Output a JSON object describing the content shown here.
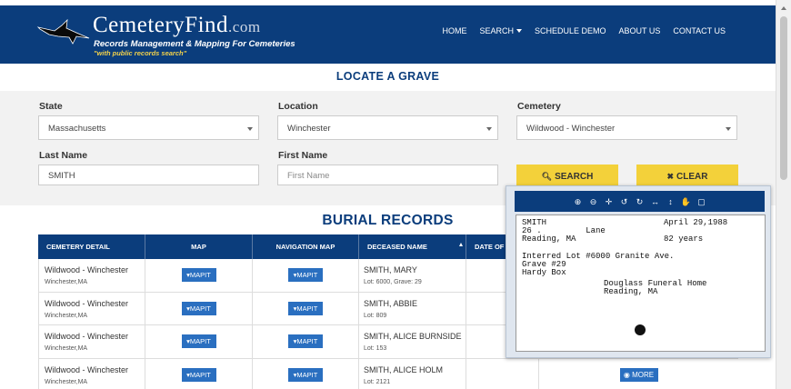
{
  "header": {
    "brand_main": "CemeteryFind",
    "brand_suffix": ".com",
    "tagline": "Records Management & Mapping For Cemeteries",
    "subtagline": "\"with public records search\"",
    "logo_icon": "bird-icon",
    "nav": [
      {
        "label": "HOME"
      },
      {
        "label": "SEARCH"
      },
      {
        "label": "SCHEDULE DEMO"
      },
      {
        "label": "ABOUT US"
      },
      {
        "label": "CONTACT US"
      }
    ],
    "colors": {
      "bar": "#0b3d7c",
      "accent": "#f3d13a"
    }
  },
  "locate": {
    "title": "LOCATE A GRAVE",
    "state_label": "State",
    "state_value": "Massachusetts",
    "location_label": "Location",
    "location_value": "Winchester",
    "cemetery_label": "Cemetery",
    "cemetery_value": "Wildwood - Winchester",
    "lastname_label": "Last Name",
    "lastname_value": "SMITH",
    "firstname_label": "First Name",
    "firstname_placeholder": "First Name",
    "search_button": "SEARCH",
    "clear_button": "CLEAR"
  },
  "burial": {
    "title": "BURIAL RECORDS",
    "columns": [
      "CEMETERY DETAIL",
      "MAP",
      "NAVIGATION MAP",
      "DECEASED NAME",
      "DATE OF D"
    ],
    "mapit_label": "MAPIT",
    "more_label": "MORE",
    "rows": [
      {
        "cemetery": "Wildwood - Winchester",
        "location": "Winchester,MA",
        "name": "SMITH, MARY",
        "lot": "Lot: 6000, Grave: 29"
      },
      {
        "cemetery": "Wildwood - Winchester",
        "location": "Winchester,MA",
        "name": "SMITH, ABBIE",
        "lot": "Lot: 809"
      },
      {
        "cemetery": "Wildwood - Winchester",
        "location": "Winchester,MA",
        "name": "SMITH, ALICE BURNSIDE",
        "lot": "Lot: 153"
      },
      {
        "cemetery": "Wildwood - Winchester",
        "location": "Winchester,MA",
        "name": "SMITH, ALICE HOLM",
        "lot": "Lot: 2121"
      }
    ]
  },
  "viewer": {
    "tools": [
      "zoom-in-icon",
      "zoom-out-icon",
      "move-icon",
      "rotate-left-icon",
      "rotate-right-icon",
      "fit-width-icon",
      "fit-height-icon",
      "hand-icon",
      "reset-icon"
    ],
    "card": {
      "line1_left": "SMITH",
      "line1_right": "April 29,1988",
      "line2_left": "26 .         Lane",
      "line3_left": "Reading, MA",
      "line3_right": "82 years",
      "line4": "Interred Lot #6000 Granite Ave.",
      "line5": "Grave #29",
      "line6": "Hardy Box",
      "line7": "Douglass Funeral Home",
      "line8": "Reading, MA"
    }
  }
}
